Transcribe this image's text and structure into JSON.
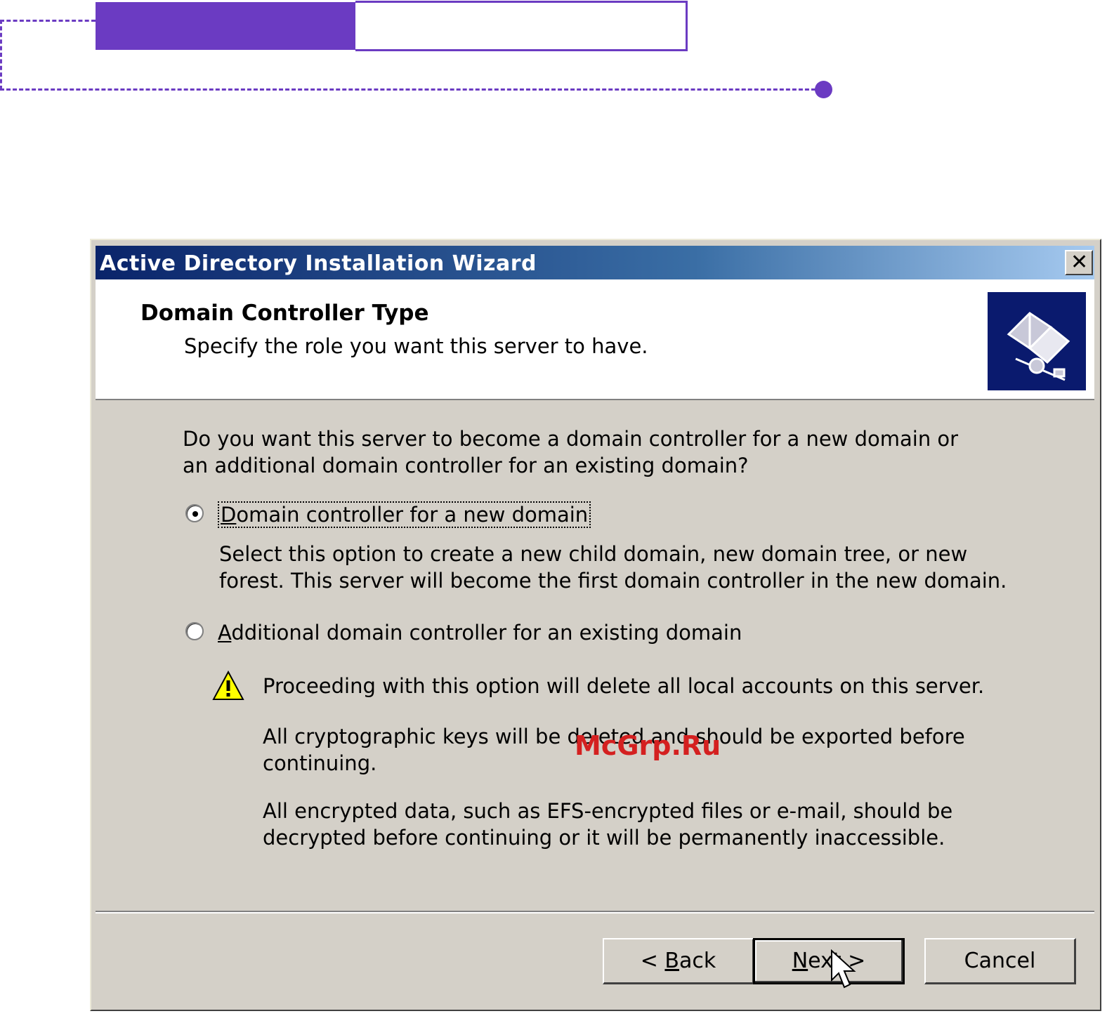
{
  "dialog": {
    "title": "Active Directory Installation Wizard",
    "close_label": "✕",
    "header_title": "Domain Controller Type",
    "header_subtitle": "Specify the role you want this server to have.",
    "question": "Do you want this server to become a domain controller for a new domain or an additional domain controller for an existing domain?",
    "options": [
      {
        "label_first": "D",
        "label_rest": "omain controller for a new domain",
        "selected": true,
        "description": "Select this option to create a new child domain, new domain tree, or new forest. This server will become the first domain controller in the new domain."
      },
      {
        "label_first": "A",
        "label_rest": "dditional domain controller for an existing domain",
        "selected": false
      }
    ],
    "warnings": [
      "Proceeding with this option will delete all local accounts on this server.",
      "All cryptographic keys will be deleted and should be exported before continuing.",
      "All encrypted data, such as EFS-encrypted files or e-mail, should be decrypted before continuing or it will be permanently inaccessible."
    ],
    "buttons": {
      "back_prefix": "< ",
      "back_key": "B",
      "back_rest": "ack",
      "next_key": "N",
      "next_rest": "ext >",
      "cancel": "Cancel"
    }
  },
  "watermark": "McGrp.Ru",
  "colors": {
    "accent": "#6b3bc2",
    "dialog_bg": "#d4d0c8",
    "titlebar_start": "#0a246a",
    "titlebar_end": "#a6caf0",
    "watermark": "#d42020"
  },
  "icons": [
    "close-icon",
    "wizard-book-icon",
    "warning-icon",
    "mouse-cursor-icon"
  ]
}
